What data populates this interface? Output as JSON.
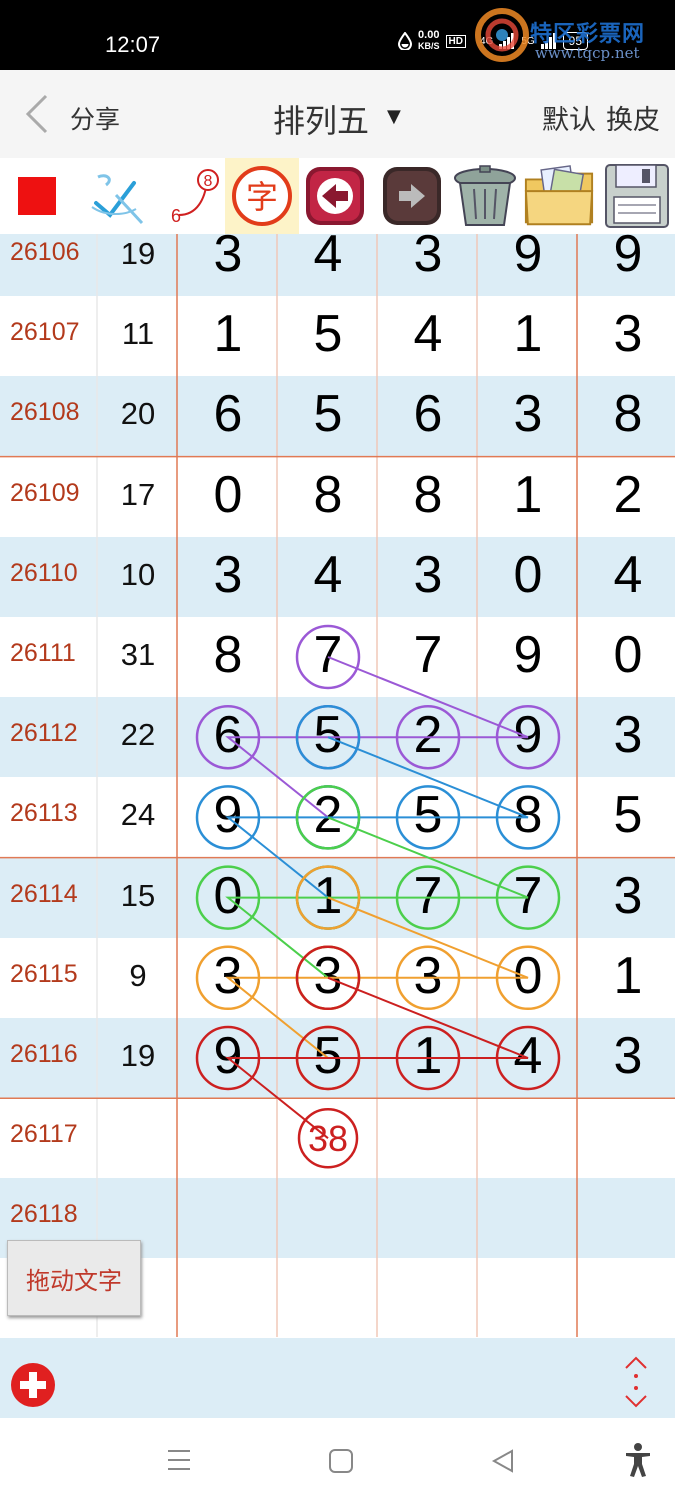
{
  "status": {
    "time": "12:07",
    "speed_value": "0.00",
    "speed_unit": "KB/S",
    "hd": "HD",
    "net1": "4G",
    "net2": "5G",
    "battery": "95"
  },
  "watermark": {
    "text": "特区彩票网",
    "url": "www.tqcp.net"
  },
  "titlebar": {
    "share": "分享",
    "title": "排列五",
    "default": "默认",
    "skin": "换皮"
  },
  "toolbar": {
    "icons": [
      "red-square-icon",
      "check-pen-icon",
      "connect-numbers-icon",
      "zi-character-icon",
      "left-arrow-icon",
      "right-arrow-icon",
      "trash-icon",
      "image-folder-icon",
      "floppy-save-icon"
    ],
    "connect_top": "8",
    "connect_bottom": "6",
    "zi": "字"
  },
  "colors": {
    "issue": "#b33a1c",
    "alt_row": "#dcedf6",
    "grid_line": "#e07a55",
    "purple": "#9b59d6",
    "blue": "#2b8fd6",
    "green": "#4ccf4c",
    "orange": "#f0a030",
    "red": "#cc2020"
  },
  "rows": [
    {
      "issue": "26106",
      "sum": "19",
      "digits": [
        "3",
        "4",
        "3",
        "9",
        "9"
      ]
    },
    {
      "issue": "26107",
      "sum": "11",
      "digits": [
        "1",
        "5",
        "4",
        "1",
        "3"
      ]
    },
    {
      "issue": "26108",
      "sum": "20",
      "digits": [
        "6",
        "5",
        "6",
        "3",
        "8"
      ]
    },
    {
      "issue": "26109",
      "sum": "17",
      "digits": [
        "0",
        "8",
        "8",
        "1",
        "2"
      ]
    },
    {
      "issue": "26110",
      "sum": "10",
      "digits": [
        "3",
        "4",
        "3",
        "0",
        "4"
      ]
    },
    {
      "issue": "26111",
      "sum": "31",
      "digits": [
        "8",
        "7",
        "7",
        "9",
        "0"
      ]
    },
    {
      "issue": "26112",
      "sum": "22",
      "digits": [
        "6",
        "5",
        "2",
        "9",
        "3"
      ]
    },
    {
      "issue": "26113",
      "sum": "24",
      "digits": [
        "9",
        "2",
        "5",
        "8",
        "5"
      ]
    },
    {
      "issue": "26114",
      "sum": "15",
      "digits": [
        "0",
        "1",
        "7",
        "7",
        "3"
      ]
    },
    {
      "issue": "26115",
      "sum": "9",
      "digits": [
        "3",
        "3",
        "3",
        "0",
        "1"
      ]
    },
    {
      "issue": "26116",
      "sum": "19",
      "digits": [
        "9",
        "5",
        "1",
        "4",
        "3"
      ]
    },
    {
      "issue": "26117",
      "sum": "",
      "digits": [
        "",
        "",
        "",
        "",
        ""
      ]
    },
    {
      "issue": "26118",
      "sum": "",
      "digits": [
        "",
        "",
        "",
        "",
        ""
      ]
    },
    {
      "issue": "",
      "sum": "",
      "digits": [
        "",
        "",
        "",
        "",
        ""
      ]
    }
  ],
  "annotations": {
    "circled_text": "38",
    "paths": [
      {
        "color": "purple",
        "cells": [
          [
            5,
            1
          ],
          [
            6,
            3
          ],
          [
            6,
            2
          ],
          [
            6,
            1
          ],
          [
            6,
            0
          ],
          [
            7,
            1
          ]
        ]
      },
      {
        "color": "blue",
        "cells": [
          [
            6,
            1
          ],
          [
            7,
            3
          ],
          [
            7,
            2
          ],
          [
            7,
            1
          ],
          [
            7,
            0
          ],
          [
            8,
            1
          ]
        ]
      },
      {
        "color": "green",
        "cells": [
          [
            7,
            1
          ],
          [
            8,
            3
          ],
          [
            8,
            2
          ],
          [
            8,
            1
          ],
          [
            8,
            0
          ],
          [
            9,
            1
          ]
        ]
      },
      {
        "color": "orange",
        "cells": [
          [
            8,
            1
          ],
          [
            9,
            3
          ],
          [
            9,
            2
          ],
          [
            9,
            1
          ],
          [
            9,
            0
          ],
          [
            10,
            1
          ]
        ]
      },
      {
        "color": "red",
        "cells": [
          [
            9,
            1
          ],
          [
            10,
            3
          ],
          [
            10,
            2
          ],
          [
            10,
            1
          ],
          [
            10,
            0
          ],
          [
            11,
            1
          ]
        ]
      }
    ]
  },
  "drag_button": "拖动文字",
  "bottombar": {
    "icons": [
      "add-icon",
      "expand-vertical-icon"
    ]
  },
  "navbar": {
    "icons": [
      "menu-icon",
      "home-icon",
      "back-icon",
      "accessibility-icon"
    ]
  }
}
